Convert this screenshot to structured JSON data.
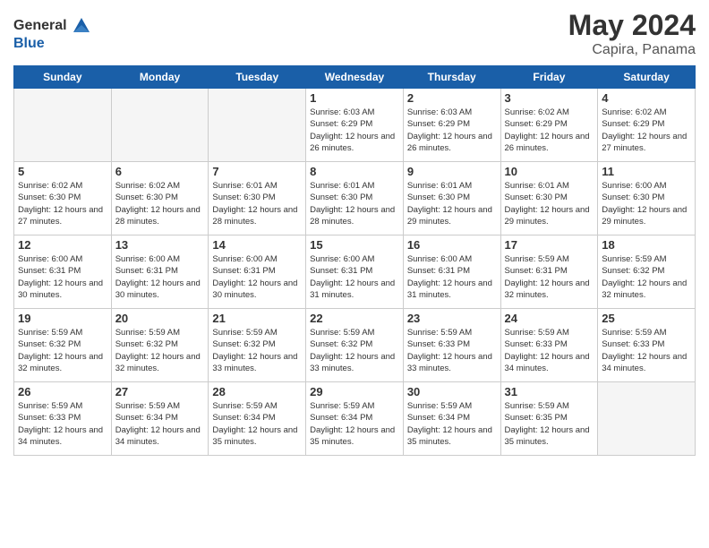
{
  "header": {
    "logo": {
      "general": "General",
      "blue": "Blue",
      "tagline": "GeneralBlue"
    },
    "title": "May 2024",
    "location": "Capira, Panama"
  },
  "days_of_week": [
    "Sunday",
    "Monday",
    "Tuesday",
    "Wednesday",
    "Thursday",
    "Friday",
    "Saturday"
  ],
  "weeks": [
    [
      {
        "day": "",
        "empty": true
      },
      {
        "day": "",
        "empty": true
      },
      {
        "day": "",
        "empty": true
      },
      {
        "day": "1",
        "sunrise": "6:03 AM",
        "sunset": "6:29 PM",
        "daylight": "12 hours and 26 minutes."
      },
      {
        "day": "2",
        "sunrise": "6:03 AM",
        "sunset": "6:29 PM",
        "daylight": "12 hours and 26 minutes."
      },
      {
        "day": "3",
        "sunrise": "6:02 AM",
        "sunset": "6:29 PM",
        "daylight": "12 hours and 26 minutes."
      },
      {
        "day": "4",
        "sunrise": "6:02 AM",
        "sunset": "6:29 PM",
        "daylight": "12 hours and 27 minutes."
      }
    ],
    [
      {
        "day": "5",
        "sunrise": "6:02 AM",
        "sunset": "6:30 PM",
        "daylight": "12 hours and 27 minutes."
      },
      {
        "day": "6",
        "sunrise": "6:02 AM",
        "sunset": "6:30 PM",
        "daylight": "12 hours and 28 minutes."
      },
      {
        "day": "7",
        "sunrise": "6:01 AM",
        "sunset": "6:30 PM",
        "daylight": "12 hours and 28 minutes."
      },
      {
        "day": "8",
        "sunrise": "6:01 AM",
        "sunset": "6:30 PM",
        "daylight": "12 hours and 28 minutes."
      },
      {
        "day": "9",
        "sunrise": "6:01 AM",
        "sunset": "6:30 PM",
        "daylight": "12 hours and 29 minutes."
      },
      {
        "day": "10",
        "sunrise": "6:01 AM",
        "sunset": "6:30 PM",
        "daylight": "12 hours and 29 minutes."
      },
      {
        "day": "11",
        "sunrise": "6:00 AM",
        "sunset": "6:30 PM",
        "daylight": "12 hours and 29 minutes."
      }
    ],
    [
      {
        "day": "12",
        "sunrise": "6:00 AM",
        "sunset": "6:31 PM",
        "daylight": "12 hours and 30 minutes."
      },
      {
        "day": "13",
        "sunrise": "6:00 AM",
        "sunset": "6:31 PM",
        "daylight": "12 hours and 30 minutes."
      },
      {
        "day": "14",
        "sunrise": "6:00 AM",
        "sunset": "6:31 PM",
        "daylight": "12 hours and 30 minutes."
      },
      {
        "day": "15",
        "sunrise": "6:00 AM",
        "sunset": "6:31 PM",
        "daylight": "12 hours and 31 minutes."
      },
      {
        "day": "16",
        "sunrise": "6:00 AM",
        "sunset": "6:31 PM",
        "daylight": "12 hours and 31 minutes."
      },
      {
        "day": "17",
        "sunrise": "5:59 AM",
        "sunset": "6:31 PM",
        "daylight": "12 hours and 32 minutes."
      },
      {
        "day": "18",
        "sunrise": "5:59 AM",
        "sunset": "6:32 PM",
        "daylight": "12 hours and 32 minutes."
      }
    ],
    [
      {
        "day": "19",
        "sunrise": "5:59 AM",
        "sunset": "6:32 PM",
        "daylight": "12 hours and 32 minutes."
      },
      {
        "day": "20",
        "sunrise": "5:59 AM",
        "sunset": "6:32 PM",
        "daylight": "12 hours and 32 minutes."
      },
      {
        "day": "21",
        "sunrise": "5:59 AM",
        "sunset": "6:32 PM",
        "daylight": "12 hours and 33 minutes."
      },
      {
        "day": "22",
        "sunrise": "5:59 AM",
        "sunset": "6:32 PM",
        "daylight": "12 hours and 33 minutes."
      },
      {
        "day": "23",
        "sunrise": "5:59 AM",
        "sunset": "6:33 PM",
        "daylight": "12 hours and 33 minutes."
      },
      {
        "day": "24",
        "sunrise": "5:59 AM",
        "sunset": "6:33 PM",
        "daylight": "12 hours and 34 minutes."
      },
      {
        "day": "25",
        "sunrise": "5:59 AM",
        "sunset": "6:33 PM",
        "daylight": "12 hours and 34 minutes."
      }
    ],
    [
      {
        "day": "26",
        "sunrise": "5:59 AM",
        "sunset": "6:33 PM",
        "daylight": "12 hours and 34 minutes."
      },
      {
        "day": "27",
        "sunrise": "5:59 AM",
        "sunset": "6:34 PM",
        "daylight": "12 hours and 34 minutes."
      },
      {
        "day": "28",
        "sunrise": "5:59 AM",
        "sunset": "6:34 PM",
        "daylight": "12 hours and 35 minutes."
      },
      {
        "day": "29",
        "sunrise": "5:59 AM",
        "sunset": "6:34 PM",
        "daylight": "12 hours and 35 minutes."
      },
      {
        "day": "30",
        "sunrise": "5:59 AM",
        "sunset": "6:34 PM",
        "daylight": "12 hours and 35 minutes."
      },
      {
        "day": "31",
        "sunrise": "5:59 AM",
        "sunset": "6:35 PM",
        "daylight": "12 hours and 35 minutes."
      },
      {
        "day": "",
        "empty": true
      }
    ]
  ]
}
